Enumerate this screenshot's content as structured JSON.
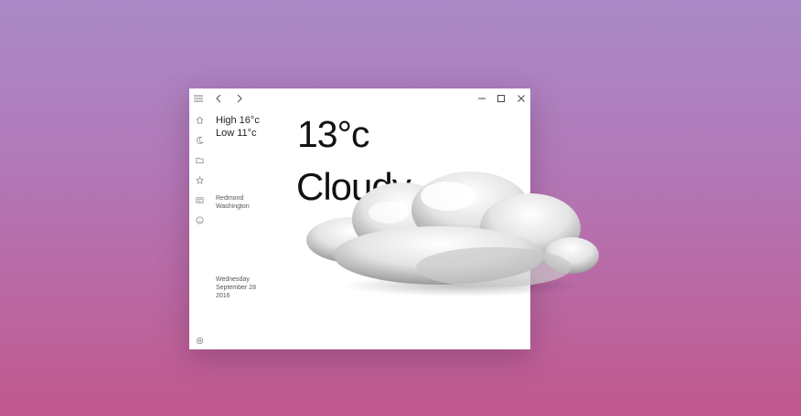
{
  "titlebar": {
    "back_icon": "chevron-left-icon",
    "forward_icon": "chevron-right-icon",
    "minimize_icon": "minimize-icon",
    "maximize_icon": "maximize-icon",
    "close_icon": "close-icon"
  },
  "sidebar": {
    "items": [
      {
        "icon": "hamburger-menu-icon"
      },
      {
        "icon": "home-icon"
      },
      {
        "icon": "moon-icon"
      },
      {
        "icon": "folder-icon"
      },
      {
        "icon": "star-icon"
      },
      {
        "icon": "news-icon"
      },
      {
        "icon": "smiley-icon"
      }
    ],
    "settings_icon": "gear-icon"
  },
  "weather": {
    "high": "High 16°c",
    "low": "Low 11°c",
    "temperature": "13°c",
    "condition": "Cloudy"
  },
  "location": {
    "city": "Redmond",
    "region": "Washington"
  },
  "date": {
    "weekday": "Wednesday",
    "month_day": "September 28",
    "year": "2016"
  },
  "colors": {
    "background_top": "#a98ac6",
    "background_bottom": "#c1588d",
    "window": "#ffffff",
    "text": "#111111"
  }
}
